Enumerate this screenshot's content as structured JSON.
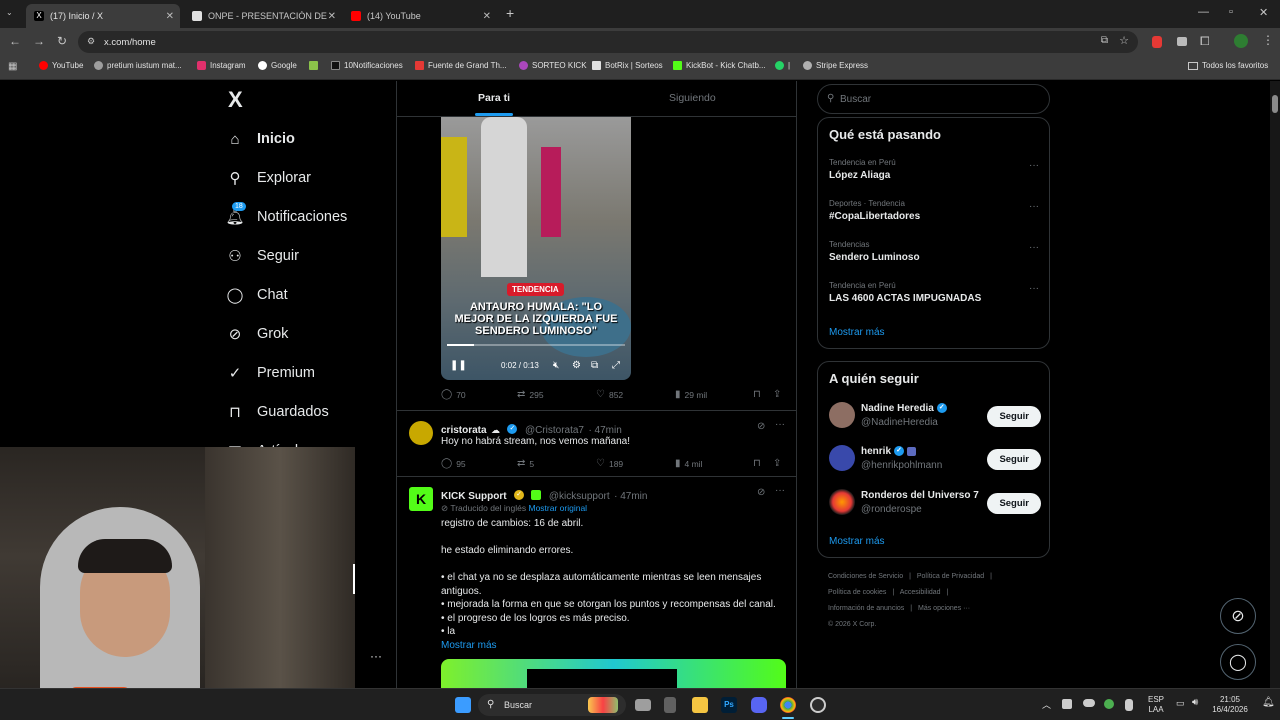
{
  "browser": {
    "tabs": [
      {
        "title": "(17) Inicio / X",
        "active": true
      },
      {
        "title": "ONPE - PRESENTACIÓN DE RES",
        "active": false
      },
      {
        "title": "(14) YouTube",
        "active": false
      }
    ],
    "url": "x.com/home",
    "bookmarks": [
      "YouTube",
      "pretium iustum mat...",
      "Instagram",
      "Google",
      "10Notificaciones",
      "Fuente de Grand Th...",
      "SORTEO KICK",
      "BotRix | Sorteos",
      "KickBot - Kick Chatb...",
      "|",
      "Stripe Express"
    ],
    "all_bookmarks": "Todos los favoritos"
  },
  "nav": {
    "logo": "X",
    "items": [
      "Inicio",
      "Explorar",
      "Notificaciones",
      "Seguir",
      "Chat",
      "Grok",
      "Premium",
      "Guardados",
      "Artículos"
    ],
    "notif_badge": "18",
    "more": "···"
  },
  "feed": {
    "tabs": [
      "Para ti",
      "Siguiendo"
    ],
    "video": {
      "tag": "TENDENCIA",
      "headline": "ANTAURO HUMALA: \"LO MEJOR DE LA IZQUIERDA FUE SENDERO LUMINOSO\"",
      "time": "0:02 / 0:13",
      "progress": 0.15
    },
    "video_actions": {
      "replies": "70",
      "reposts": "295",
      "likes": "852",
      "views": "29 mil"
    },
    "tweets": [
      {
        "name": "cristorata",
        "emoji": "☁",
        "handle": "@Cristorata7",
        "time": "· 47min",
        "text": "Hoy no habrá stream, nos vemos mañana!",
        "replies": "95",
        "reposts": "5",
        "likes": "189",
        "views": "4 mil"
      },
      {
        "name": "KICK Support",
        "handle": "@kicksupport",
        "time": "· 47min",
        "translated": "Traducido del inglés",
        "show_original": "Mostrar original",
        "lines": [
          "registro de cambios: 16 de abril.",
          "",
          "he estado eliminando errores.",
          "",
          "• el chat ya no se desplaza automáticamente mientras se leen mensajes antiguos.",
          "• mejorada la forma en que se otorgan los puntos y recompensas del canal.",
          "• el progreso de los logros es más preciso.",
          "• la"
        ],
        "show_more": "Mostrar más"
      }
    ]
  },
  "sidebar": {
    "search_placeholder": "Buscar",
    "trending_title": "Qué está pasando",
    "trends": [
      {
        "meta": "Tendencia en Perú",
        "name": "López Aliaga"
      },
      {
        "meta": "Deportes · Tendencia",
        "name": "#CopaLibertadores"
      },
      {
        "meta": "Tendencias",
        "name": "Sendero Luminoso"
      },
      {
        "meta": "Tendencia en Perú",
        "name": "LAS 4600 ACTAS IMPUGNADAS"
      }
    ],
    "show_more": "Mostrar más",
    "follow_title": "A quién seguir",
    "follow": [
      {
        "name": "Nadine Heredia",
        "handle": "@NadineHeredia",
        "button": "Seguir"
      },
      {
        "name": "henrik",
        "handle": "@henrikpohlmann",
        "button": "Seguir"
      },
      {
        "name": "Ronderos del Universo 7",
        "handle": "@ronderospe",
        "button": "Seguir"
      }
    ],
    "follow_more": "Mostrar más",
    "footer": [
      "Condiciones de Servicio",
      "|",
      "Política de Privacidad",
      "|",
      "Política de cookies",
      "|",
      "Accesibilidad",
      "|",
      "Información de anuncios",
      "|",
      "Más opciones ···",
      "© 2026 X Corp."
    ]
  },
  "taskbar": {
    "search": "Buscar",
    "lang": "ESP",
    "lang2": "LAA",
    "time": "21:05",
    "date": "16/4/2026"
  },
  "colors": {
    "accent": "#1d9bf0",
    "bg": "#000000",
    "border": "#2f3336",
    "muted": "#71767b"
  }
}
